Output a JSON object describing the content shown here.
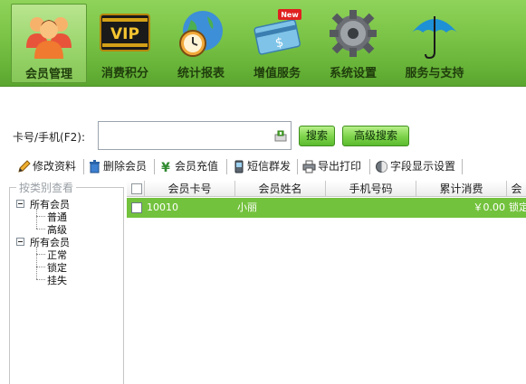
{
  "ribbon": {
    "items": [
      {
        "label": "会员管理",
        "icon": "members-icon",
        "active": true
      },
      {
        "label": "消费积分",
        "icon": "vip-card-icon",
        "active": false
      },
      {
        "label": "统计报表",
        "icon": "globe-clock-icon",
        "active": false
      },
      {
        "label": "增值服务",
        "icon": "money-card-icon",
        "active": false,
        "badge": "New"
      },
      {
        "label": "系统设置",
        "icon": "gear-icon",
        "active": false
      },
      {
        "label": "服务与支持",
        "icon": "umbrella-icon",
        "active": false
      }
    ],
    "vip_text": "VIP",
    "colors": {
      "ribbon_green": "#7cc548",
      "active_tab": "#a6dc7a",
      "badge_red": "#e02020"
    }
  },
  "search": {
    "label": "卡号/手机(F2):",
    "value": "",
    "search_button": "搜索",
    "advanced_button": "高级搜索"
  },
  "toolbar": {
    "edit": "修改资料",
    "delete": "删除会员",
    "recharge": "会员充值",
    "sms": "短信群发",
    "print": "导出打印",
    "fields": "字段显示设置"
  },
  "tree": {
    "title": "按类别查看",
    "groups": [
      {
        "label": "所有会员",
        "children": [
          "普通",
          "高级"
        ]
      },
      {
        "label": "所有会员",
        "children": [
          "正常",
          "锁定",
          "挂失"
        ]
      }
    ]
  },
  "grid": {
    "columns": [
      "会员卡号",
      "会员姓名",
      "手机号码",
      "累计消费",
      "会"
    ],
    "rows": [
      {
        "card": "10010",
        "name": "小丽",
        "phone": "",
        "total": "￥0.00",
        "status": "锁定"
      }
    ],
    "colors": {
      "selected_row": "#7ac943"
    }
  }
}
